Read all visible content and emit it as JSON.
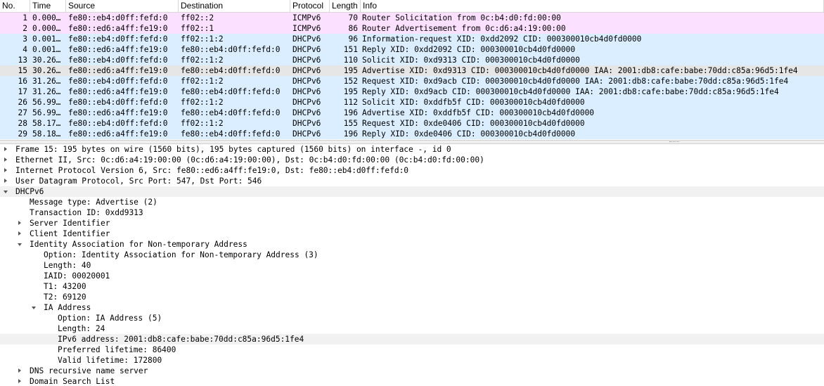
{
  "columns": {
    "no": "No.",
    "time": "Time",
    "source": "Source",
    "destination": "Destination",
    "protocol": "Protocol",
    "length": "Length",
    "info": "Info"
  },
  "colors": {
    "icmpv6_row": "#fce0ff",
    "dhcpv6_row": "#daeeff",
    "selected_row": "#e6e6e6",
    "highlight_row": "#f1f1f1"
  },
  "packets": [
    {
      "no": "1",
      "time": "0.000…",
      "source": "fe80::eb4:d0ff:fefd:0",
      "destination": "ff02::2",
      "protocol": "ICMPv6",
      "length": "70",
      "info": "Router Solicitation from 0c:b4:d0:fd:00:00",
      "color": "icmpv6",
      "selected": false
    },
    {
      "no": "2",
      "time": "0.000…",
      "source": "fe80::ed6:a4ff:fe19:0",
      "destination": "ff02::1",
      "protocol": "ICMPv6",
      "length": "86",
      "info": "Router Advertisement from 0c:d6:a4:19:00:00",
      "color": "icmpv6",
      "selected": false
    },
    {
      "no": "3",
      "time": "0.001…",
      "source": "fe80::eb4:d0ff:fefd:0",
      "destination": "ff02::1:2",
      "protocol": "DHCPv6",
      "length": "96",
      "info": "Information-request XID: 0xdd2092 CID: 000300010cb4d0fd0000",
      "color": "dhcpv6",
      "selected": false
    },
    {
      "no": "4",
      "time": "0.001…",
      "source": "fe80::ed6:a4ff:fe19:0",
      "destination": "fe80::eb4:d0ff:fefd:0",
      "protocol": "DHCPv6",
      "length": "151",
      "info": "Reply XID: 0xdd2092 CID: 000300010cb4d0fd0000",
      "color": "dhcpv6",
      "selected": false
    },
    {
      "no": "13",
      "time": "30.26…",
      "source": "fe80::eb4:d0ff:fefd:0",
      "destination": "ff02::1:2",
      "protocol": "DHCPv6",
      "length": "110",
      "info": "Solicit XID: 0xd9313 CID: 000300010cb4d0fd0000",
      "color": "dhcpv6",
      "selected": false
    },
    {
      "no": "15",
      "time": "30.26…",
      "source": "fe80::ed6:a4ff:fe19:0",
      "destination": "fe80::eb4:d0ff:fefd:0",
      "protocol": "DHCPv6",
      "length": "195",
      "info": "Advertise XID: 0xd9313 CID: 000300010cb4d0fd0000 IAA: 2001:db8:cafe:babe:70dd:c85a:96d5:1fe4",
      "color": "dhcpv6",
      "selected": true
    },
    {
      "no": "16",
      "time": "31.26…",
      "source": "fe80::eb4:d0ff:fefd:0",
      "destination": "ff02::1:2",
      "protocol": "DHCPv6",
      "length": "152",
      "info": "Request XID: 0xd9acb CID: 000300010cb4d0fd0000 IAA: 2001:db8:cafe:babe:70dd:c85a:96d5:1fe4",
      "color": "dhcpv6",
      "selected": false
    },
    {
      "no": "17",
      "time": "31.26…",
      "source": "fe80::ed6:a4ff:fe19:0",
      "destination": "fe80::eb4:d0ff:fefd:0",
      "protocol": "DHCPv6",
      "length": "195",
      "info": "Reply XID: 0xd9acb CID: 000300010cb4d0fd0000 IAA: 2001:db8:cafe:babe:70dd:c85a:96d5:1fe4",
      "color": "dhcpv6",
      "selected": false
    },
    {
      "no": "26",
      "time": "56.99…",
      "source": "fe80::eb4:d0ff:fefd:0",
      "destination": "ff02::1:2",
      "protocol": "DHCPv6",
      "length": "112",
      "info": "Solicit XID: 0xddfb5f CID: 000300010cb4d0fd0000",
      "color": "dhcpv6",
      "selected": false
    },
    {
      "no": "27",
      "time": "56.99…",
      "source": "fe80::ed6:a4ff:fe19:0",
      "destination": "fe80::eb4:d0ff:fefd:0",
      "protocol": "DHCPv6",
      "length": "196",
      "info": "Advertise XID: 0xddfb5f CID: 000300010cb4d0fd0000",
      "color": "dhcpv6",
      "selected": false
    },
    {
      "no": "28",
      "time": "58.17…",
      "source": "fe80::eb4:d0ff:fefd:0",
      "destination": "ff02::1:2",
      "protocol": "DHCPv6",
      "length": "155",
      "info": "Request XID: 0xde0406 CID: 000300010cb4d0fd0000",
      "color": "dhcpv6",
      "selected": false
    },
    {
      "no": "29",
      "time": "58.18…",
      "source": "fe80::ed6:a4ff:fe19:0",
      "destination": "fe80::eb4:d0ff:fefd:0",
      "protocol": "DHCPv6",
      "length": "196",
      "info": "Reply XID: 0xde0406 CID: 000300010cb4d0fd0000",
      "color": "dhcpv6",
      "selected": false
    }
  ],
  "details": [
    {
      "level": 0,
      "toggle": "collapsed",
      "text": "Frame 15: 195 bytes on wire (1560 bits), 195 bytes captured (1560 bits) on interface -, id 0"
    },
    {
      "level": 0,
      "toggle": "collapsed",
      "text": "Ethernet II, Src: 0c:d6:a4:19:00:00 (0c:d6:a4:19:00:00), Dst: 0c:b4:d0:fd:00:00 (0c:b4:d0:fd:00:00)"
    },
    {
      "level": 0,
      "toggle": "collapsed",
      "text": "Internet Protocol Version 6, Src: fe80::ed6:a4ff:fe19:0, Dst: fe80::eb4:d0ff:fefd:0"
    },
    {
      "level": 0,
      "toggle": "collapsed",
      "text": "User Datagram Protocol, Src Port: 547, Dst Port: 546"
    },
    {
      "level": 0,
      "toggle": "expanded",
      "text": "DHCPv6",
      "shaded": true
    },
    {
      "level": 1,
      "toggle": "none",
      "text": "Message type: Advertise (2)"
    },
    {
      "level": 1,
      "toggle": "none",
      "text": "Transaction ID: 0xdd9313"
    },
    {
      "level": 1,
      "toggle": "collapsed",
      "text": "Server Identifier"
    },
    {
      "level": 1,
      "toggle": "collapsed",
      "text": "Client Identifier"
    },
    {
      "level": 1,
      "toggle": "expanded",
      "text": "Identity Association for Non-temporary Address"
    },
    {
      "level": 2,
      "toggle": "none",
      "text": "Option: Identity Association for Non-temporary Address (3)"
    },
    {
      "level": 2,
      "toggle": "none",
      "text": "Length: 40"
    },
    {
      "level": 2,
      "toggle": "none",
      "text": "IAID: 00020001"
    },
    {
      "level": 2,
      "toggle": "none",
      "text": "T1: 43200"
    },
    {
      "level": 2,
      "toggle": "none",
      "text": "T2: 69120"
    },
    {
      "level": 2,
      "toggle": "expanded",
      "text": "IA Address"
    },
    {
      "level": 3,
      "toggle": "none",
      "text": "Option: IA Address (5)"
    },
    {
      "level": 3,
      "toggle": "none",
      "text": "Length: 24"
    },
    {
      "level": 3,
      "toggle": "none",
      "text": "IPv6 address: 2001:db8:cafe:babe:70dd:c85a:96d5:1fe4",
      "highlighted": true
    },
    {
      "level": 3,
      "toggle": "none",
      "text": "Preferred lifetime: 86400"
    },
    {
      "level": 3,
      "toggle": "none",
      "text": "Valid lifetime: 172800"
    },
    {
      "level": 1,
      "toggle": "collapsed",
      "text": "DNS recursive name server"
    },
    {
      "level": 1,
      "toggle": "collapsed",
      "text": "Domain Search List"
    }
  ]
}
